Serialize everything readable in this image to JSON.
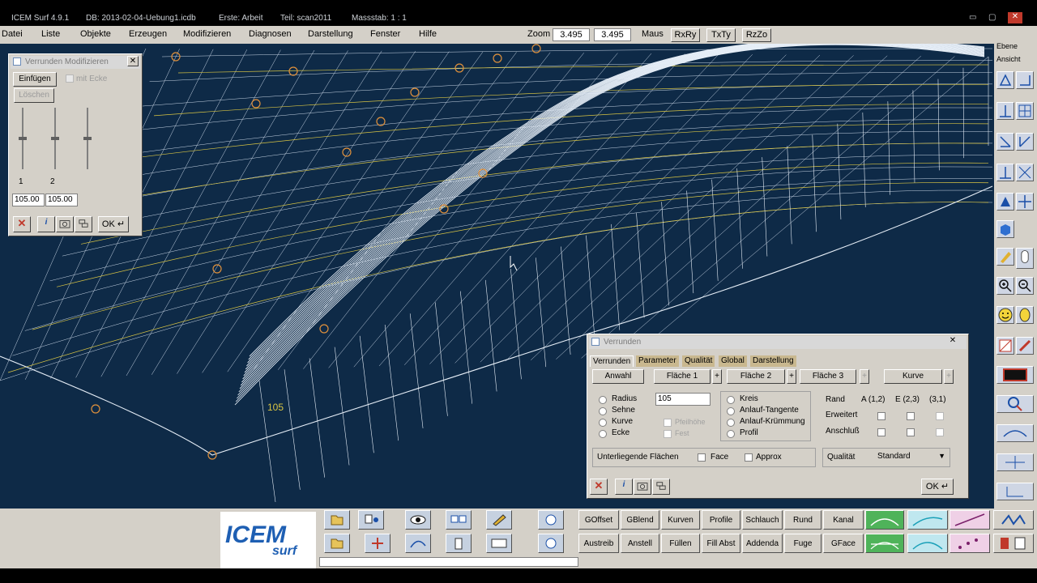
{
  "titlebar": {
    "app": "ICEM Surf 4.9.1",
    "db": "DB: 2013-02-04-Uebung1.icdb",
    "erste": "Erste: Arbeit",
    "teil": "Teil: scan2011",
    "massstab": "Massstab: 1 : 1"
  },
  "menu": {
    "items": [
      "Datei",
      "Liste",
      "Objekte",
      "Erzeugen",
      "Modifizieren",
      "Diagnosen",
      "Darstellung",
      "Fenster",
      "Hilfe"
    ],
    "zoom_label": "Zoom",
    "zoom_value1": "3.495",
    "zoom_value2": "3.495",
    "maus_label": "Maus",
    "btn_rxry": "RxRy",
    "btn_txty": "TxTy",
    "btn_rzzo": "RzZo"
  },
  "rightbar": {
    "ebene": "Ebene",
    "ansicht": "Ansicht"
  },
  "mod_panel": {
    "title": "Verrunden Modifizieren",
    "einfuegen": "Einfügen",
    "mit_ecke": "mit Ecke",
    "loeschen": "Löschen",
    "slider1": "1",
    "slider2": "2",
    "val1": "105.00",
    "val2": "105.00",
    "ok": "OK"
  },
  "verrunden": {
    "title": "Verrunden",
    "tabs": [
      "Verrunden",
      "Parameter",
      "Qualität",
      "Global",
      "Darstellung"
    ],
    "btn_anwahl": "Anwahl",
    "btn_flaeche1": "Fläche 1",
    "btn_flaeche2": "Fläche 2",
    "btn_flaeche3": "Fläche 3",
    "btn_kurve": "Kurve",
    "plus": "+",
    "opt_radius": "Radius",
    "opt_sehne": "Sehne",
    "opt_kurve": "Kurve",
    "opt_ecke": "Ecke",
    "radius_value": "105",
    "sub_opt1": "Pfeilhöhe",
    "sub_opt2": "Fest",
    "opt_kreis": "Kreis",
    "opt_anlauf_tangente": "Anlauf-Tangente",
    "opt_anlauf_kruemmung": "Anlauf-Krümmung",
    "opt_profil": "Profil",
    "rand": "Rand",
    "col_a": "A (1,2)",
    "col_e": "E (2,3)",
    "col_3": "(3,1)",
    "erweitert": "Erweitert",
    "anschluss": "Anschluß",
    "unterliegende": "Unterliegende Flächen",
    "face": "Face",
    "approx": "Approx",
    "qualitaet": "Qualität",
    "qualitaet_value": "Standard",
    "ok": "OK"
  },
  "bottom": {
    "logo_main": "ICEM",
    "logo_sub": "surf",
    "row1": [
      "GOffset",
      "GBlend",
      "Kurven",
      "Profile",
      "Schlauch",
      "Rund",
      "Kanal"
    ],
    "row2": [
      "Austreib",
      "Anstell",
      "Füllen",
      "Fill Abst",
      "Addenda",
      "Fuge",
      "GFace"
    ]
  },
  "viewport": {
    "label": "105"
  },
  "colors": {
    "viewport_bg": "#0e2a47",
    "wire_white": "#e6eef7",
    "wire_yellow": "#d8c443",
    "wire_orange": "#e0913c",
    "panel_bg": "#d4d0c8",
    "tab_bg": "#c9b88f"
  }
}
